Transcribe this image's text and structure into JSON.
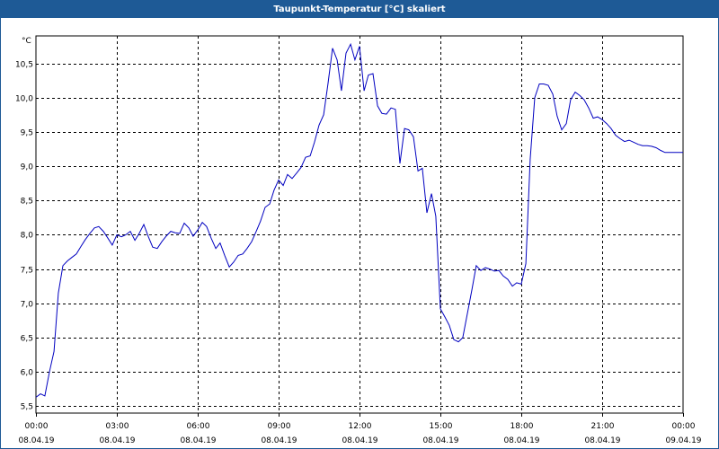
{
  "window": {
    "title": "Taupunkt-Temperatur [°C] skaliert"
  },
  "chart_data": {
    "type": "line",
    "title": "Taupunkt-Temperatur [°C] skaliert",
    "ylabel": "°C",
    "xlabel": "",
    "ylim": [
      5.4,
      10.9
    ],
    "y_ticks": [
      "5,5",
      "6,0",
      "6,5",
      "7,0",
      "7,5",
      "8,0",
      "8,5",
      "9,0",
      "9,5",
      "10,0",
      "10,5"
    ],
    "y_tick_values": [
      5.5,
      6.0,
      6.5,
      7.0,
      7.5,
      8.0,
      8.5,
      9.0,
      9.5,
      10.0,
      10.5
    ],
    "x_range_hours": [
      0,
      24
    ],
    "x_ticks": [
      {
        "hour": 0,
        "time": "00:00",
        "date": "08.04.19"
      },
      {
        "hour": 3,
        "time": "03:00",
        "date": "08.04.19"
      },
      {
        "hour": 6,
        "time": "06:00",
        "date": "08.04.19"
      },
      {
        "hour": 9,
        "time": "09:00",
        "date": "08.04.19"
      },
      {
        "hour": 12,
        "time": "12:00",
        "date": "08.04.19"
      },
      {
        "hour": 15,
        "time": "15:00",
        "date": "08.04.19"
      },
      {
        "hour": 18,
        "time": "18:00",
        "date": "08.04.19"
      },
      {
        "hour": 21,
        "time": "21:00",
        "date": "08.04.19"
      },
      {
        "hour": 24,
        "time": "00:00",
        "date": "09.04.19"
      }
    ],
    "grid": true,
    "line_color": "#0000c0",
    "series": [
      {
        "x": [
          0.0,
          0.17,
          0.33,
          0.5,
          0.67,
          0.83,
          1.0,
          1.17,
          1.33,
          1.5,
          1.67,
          1.83,
          2.0,
          2.17,
          2.33,
          2.5,
          2.67,
          2.83,
          3.0,
          3.17,
          3.33,
          3.5,
          3.67,
          3.83,
          4.0,
          4.17,
          4.33,
          4.5,
          4.67,
          4.83,
          5.0,
          5.17,
          5.33,
          5.5,
          5.67,
          5.83,
          6.0,
          6.17,
          6.33,
          6.5,
          6.67,
          6.83,
          7.0,
          7.17,
          7.33,
          7.5,
          7.67,
          7.83,
          8.0,
          8.17,
          8.33,
          8.5,
          8.67,
          8.83,
          9.0,
          9.17,
          9.33,
          9.5,
          9.67,
          9.83,
          10.0,
          10.17,
          10.33,
          10.5,
          10.67,
          10.83,
          11.0,
          11.17,
          11.33,
          11.5,
          11.67,
          11.83,
          12.0,
          12.17,
          12.33,
          12.5,
          12.67,
          12.83,
          13.0,
          13.17,
          13.33,
          13.5,
          13.67,
          13.83,
          14.0,
          14.17,
          14.33,
          14.5,
          14.67,
          14.83,
          15.0,
          15.17,
          15.33,
          15.5,
          15.67,
          15.83,
          16.0,
          16.17,
          16.33,
          16.5,
          16.67,
          16.83,
          17.0,
          17.17,
          17.33,
          17.5,
          17.67,
          17.83,
          18.0,
          18.17,
          18.33,
          18.5,
          18.67,
          18.83,
          19.0,
          19.17,
          19.33,
          19.5,
          19.67,
          19.83,
          20.0,
          20.17,
          20.33,
          20.5,
          20.67,
          20.83,
          21.0,
          21.17,
          21.33,
          21.5,
          21.67,
          21.83,
          22.0,
          22.17,
          22.33,
          22.5,
          22.67,
          22.83,
          23.0,
          23.17,
          23.33,
          23.5,
          23.67,
          23.83,
          24.0
        ],
        "y": [
          5.63,
          5.68,
          5.65,
          6.0,
          6.3,
          7.15,
          7.55,
          7.62,
          7.67,
          7.72,
          7.83,
          7.93,
          8.02,
          8.1,
          8.12,
          8.05,
          7.95,
          7.85,
          8.0,
          7.97,
          8.0,
          8.05,
          7.92,
          8.02,
          8.15,
          7.97,
          7.82,
          7.8,
          7.9,
          7.98,
          8.05,
          8.03,
          8.02,
          8.17,
          8.1,
          7.98,
          8.07,
          8.18,
          8.12,
          7.95,
          7.8,
          7.88,
          7.7,
          7.53,
          7.6,
          7.7,
          7.72,
          7.8,
          7.9,
          8.05,
          8.2,
          8.4,
          8.45,
          8.65,
          8.8,
          8.72,
          8.88,
          8.82,
          8.9,
          8.98,
          9.13,
          9.15,
          9.35,
          9.6,
          9.75,
          10.2,
          10.72,
          10.55,
          10.1,
          10.65,
          10.78,
          10.55,
          10.75,
          10.1,
          10.33,
          10.35,
          9.88,
          9.77,
          9.76,
          9.85,
          9.83,
          9.04,
          9.55,
          9.53,
          9.43,
          8.93,
          8.97,
          8.32,
          8.6,
          8.27,
          6.92,
          6.8,
          6.68,
          6.47,
          6.44,
          6.5,
          6.85,
          7.2,
          7.55,
          7.48,
          7.52,
          7.5,
          7.47,
          7.48,
          7.4,
          7.35,
          7.25,
          7.3,
          7.28,
          7.58,
          9.1,
          10.0,
          10.2,
          10.2,
          10.18,
          10.05,
          9.73,
          9.53,
          9.62,
          9.97,
          10.08,
          10.03,
          9.97,
          9.85,
          9.7,
          9.72,
          9.68,
          9.62,
          9.55,
          9.45,
          9.4,
          9.36,
          9.38,
          9.35,
          9.32,
          9.3,
          9.3,
          9.29,
          9.27,
          9.23,
          9.2,
          9.2,
          9.2,
          9.2,
          9.2
        ]
      }
    ]
  }
}
